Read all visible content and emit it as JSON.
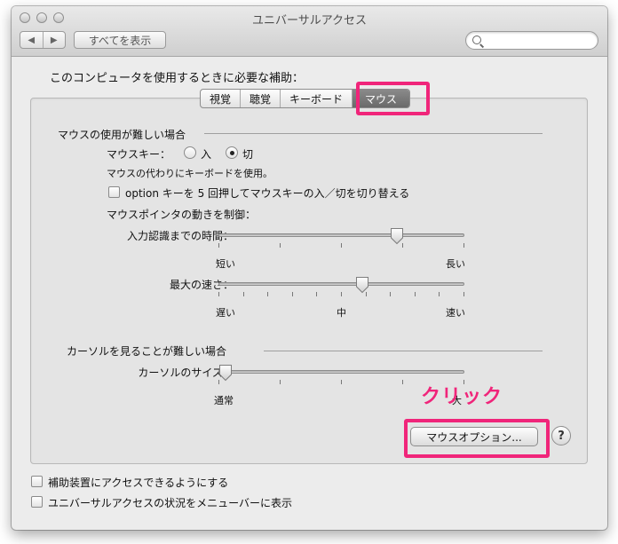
{
  "window": {
    "title": "ユニバーサルアクセス"
  },
  "toolbar": {
    "back_label": "◀",
    "forward_label": "▶",
    "show_all_label": "すべてを表示",
    "search_placeholder": ""
  },
  "heading": "このコンピュータを使用するときに必要な補助：",
  "tabs": [
    {
      "label": "視覚",
      "active": false
    },
    {
      "label": "聴覚",
      "active": false
    },
    {
      "label": "キーボード",
      "active": false
    },
    {
      "label": "マウス",
      "active": true
    }
  ],
  "mouse_section": {
    "title": "マウスの使用が難しい場合",
    "mouse_keys_label": "マウスキー：",
    "radio_on_label": "入",
    "radio_off_label": "切",
    "selected": "切",
    "mouse_keys_note": "マウスの代わりにキーボードを使用。",
    "option_checkbox_label": "option キーを 5 回押してマウスキーの入／切を切り替える",
    "option_checked": false,
    "pointer_control_label": "マウスポインタの動きを制御：",
    "delay": {
      "label": "入力認識までの時間：",
      "min_label": "短い",
      "max_label": "長い",
      "value": 0.74
    },
    "speed": {
      "label": "最大の速さ：",
      "min_label": "遅い",
      "mid_label": "中",
      "max_label": "速い",
      "value": 0.59
    }
  },
  "cursor_section": {
    "title": "カーソルを見ることが難しい場合",
    "size": {
      "label": "カーソルのサイズ：",
      "min_label": "通常",
      "max_label": "大",
      "value": 0.0
    }
  },
  "buttons": {
    "mouse_options_label": "マウスオプション...",
    "help_label": "?"
  },
  "annotation": {
    "text": "クリック",
    "color": "#f0257a"
  },
  "footer": {
    "assistive_label": "補助装置にアクセスできるようにする",
    "assistive_checked": false,
    "menubar_label": "ユニバーサルアクセスの状況をメニューバーに表示",
    "menubar_checked": false
  }
}
